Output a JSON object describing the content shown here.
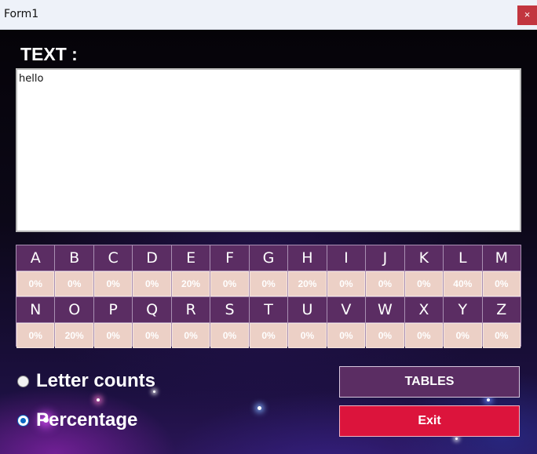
{
  "window": {
    "title": "Form1",
    "close_glyph": "×"
  },
  "text_section": {
    "label": "TEXT :",
    "value": "hello"
  },
  "letters_row1": [
    {
      "letter": "A",
      "value": "0%"
    },
    {
      "letter": "B",
      "value": "0%"
    },
    {
      "letter": "C",
      "value": "0%"
    },
    {
      "letter": "D",
      "value": "0%"
    },
    {
      "letter": "E",
      "value": "20%"
    },
    {
      "letter": "F",
      "value": "0%"
    },
    {
      "letter": "G",
      "value": "0%"
    },
    {
      "letter": "H",
      "value": "20%"
    },
    {
      "letter": "I",
      "value": "0%"
    },
    {
      "letter": "J",
      "value": "0%"
    },
    {
      "letter": "K",
      "value": "0%"
    },
    {
      "letter": "L",
      "value": "40%"
    },
    {
      "letter": "M",
      "value": "0%"
    }
  ],
  "letters_row2": [
    {
      "letter": "N",
      "value": "0%"
    },
    {
      "letter": "O",
      "value": "20%"
    },
    {
      "letter": "P",
      "value": "0%"
    },
    {
      "letter": "Q",
      "value": "0%"
    },
    {
      "letter": "R",
      "value": "0%"
    },
    {
      "letter": "S",
      "value": "0%"
    },
    {
      "letter": "T",
      "value": "0%"
    },
    {
      "letter": "U",
      "value": "0%"
    },
    {
      "letter": "V",
      "value": "0%"
    },
    {
      "letter": "W",
      "value": "0%"
    },
    {
      "letter": "X",
      "value": "0%"
    },
    {
      "letter": "Y",
      "value": "0%"
    },
    {
      "letter": "Z",
      "value": "0%"
    }
  ],
  "options": {
    "letter_counts": {
      "label": "Letter counts",
      "checked": false
    },
    "percentage": {
      "label": "Percentage",
      "checked": true
    }
  },
  "buttons": {
    "tables": "TABLES",
    "exit": "Exit"
  },
  "colors": {
    "letter_cell": "#5b2d63",
    "value_cell": "#ecd0c6",
    "tables_button": "#5b2d63",
    "exit_button": "#dc143c"
  }
}
